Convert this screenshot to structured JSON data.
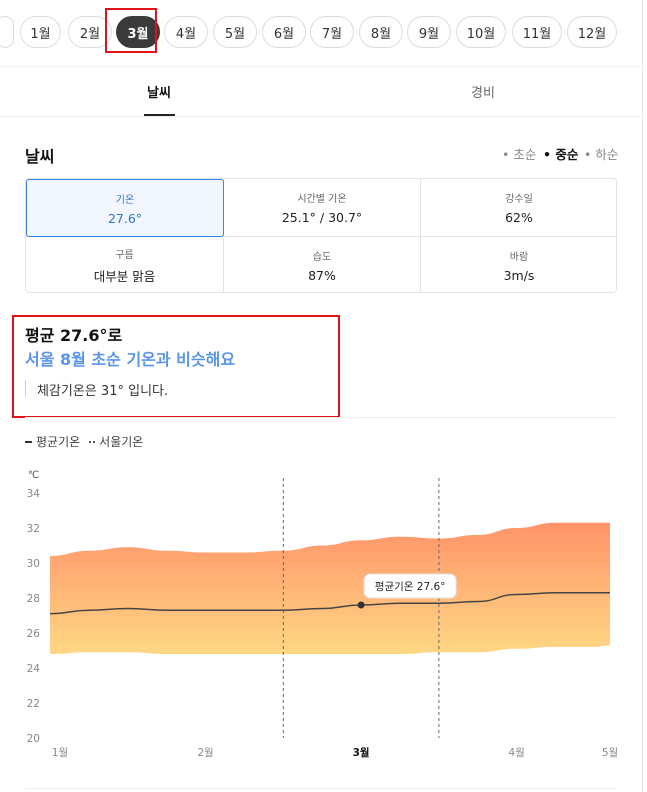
{
  "months": [
    {
      "label": "1월",
      "active": false
    },
    {
      "label": "2월",
      "active": false
    },
    {
      "label": "3월",
      "active": true
    },
    {
      "label": "4월",
      "active": false
    },
    {
      "label": "5월",
      "active": false
    },
    {
      "label": "6월",
      "active": false
    },
    {
      "label": "7월",
      "active": false
    },
    {
      "label": "8월",
      "active": false
    },
    {
      "label": "9월",
      "active": false
    },
    {
      "label": "10월",
      "active": false
    },
    {
      "label": "11월",
      "active": false
    },
    {
      "label": "12월",
      "active": false
    }
  ],
  "tabs": {
    "weather": "날씨",
    "cost": "경비"
  },
  "section": {
    "title": "날씨",
    "periods": {
      "early": "• 초순",
      "mid": "• 중순",
      "late": "• 하순"
    },
    "selected_period": "mid"
  },
  "grid": {
    "temp": {
      "label": "기온",
      "value": "27.6°"
    },
    "hourly": {
      "label": "시간별 기온",
      "value": "25.1° / 30.7°"
    },
    "rain": {
      "label": "강수일",
      "value": "62%"
    },
    "cloud": {
      "label": "구름",
      "value": "대부분 맑음"
    },
    "humidity": {
      "label": "습도",
      "value": "87%"
    },
    "wind": {
      "label": "바람",
      "value": "3m/s"
    }
  },
  "summary": {
    "title": "평균 27.6°로",
    "subtitle": "서울 8월 초순 기온과 비슷해요",
    "feels": "체감기온은 31° 입니다."
  },
  "legend": {
    "avg": "평균기온",
    "seoul": "서울기온"
  },
  "chart_data": {
    "type": "area",
    "unit": "℃",
    "ylim": [
      20,
      34
    ],
    "y_ticks": [
      20,
      22,
      24,
      26,
      28,
      30,
      32,
      34
    ],
    "x_ticks": [
      {
        "label": "1월",
        "x": 0,
        "bold": false
      },
      {
        "label": "2월",
        "x": 1,
        "bold": false
      },
      {
        "label": "3월",
        "x": 2,
        "bold": true
      },
      {
        "label": "4월",
        "x": 3,
        "bold": false
      },
      {
        "label": "5월",
        "x": 3.6,
        "bold": false
      }
    ],
    "x": [
      0,
      0.25,
      0.5,
      0.75,
      1.0,
      1.25,
      1.5,
      1.75,
      2.0,
      2.25,
      2.5,
      2.75,
      3.0,
      3.25,
      3.5,
      3.6
    ],
    "series": [
      {
        "name": "평균기온",
        "values": [
          27.1,
          27.3,
          27.4,
          27.3,
          27.3,
          27.3,
          27.3,
          27.4,
          27.6,
          27.7,
          27.7,
          27.8,
          28.2,
          28.3,
          28.3,
          28.3
        ]
      }
    ],
    "band_high": [
      30.4,
      30.7,
      30.9,
      30.7,
      30.6,
      30.6,
      30.7,
      31.0,
      31.3,
      31.5,
      31.4,
      31.6,
      32.0,
      32.3,
      32.3,
      32.3
    ],
    "band_low": [
      24.8,
      24.9,
      24.9,
      24.8,
      24.8,
      24.8,
      24.8,
      24.8,
      24.8,
      24.8,
      24.9,
      24.9,
      25.1,
      25.2,
      25.2,
      25.3
    ],
    "period_bounds": [
      1.5,
      2.5
    ],
    "marker": {
      "x": 2.0,
      "y": 27.6,
      "label": "평균기온 27.6°"
    },
    "colors": {
      "band_top": "#ff8a5c",
      "band_bottom": "#ffd47a",
      "line": "#444444"
    }
  }
}
